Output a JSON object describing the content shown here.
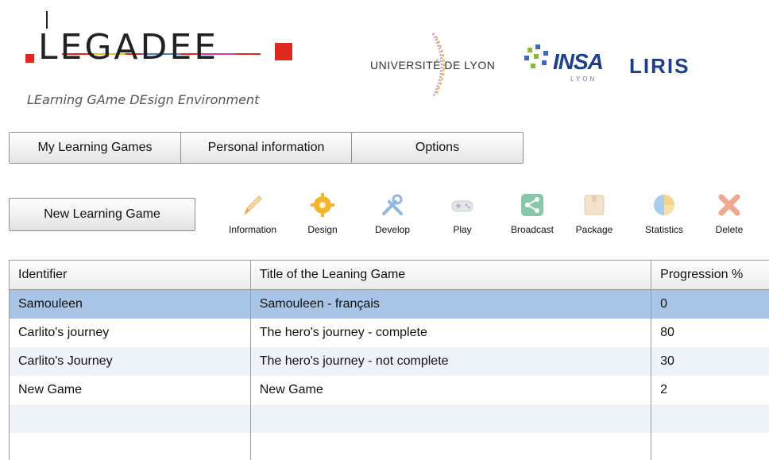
{
  "header": {
    "logo_title": "LEGADEE",
    "logo_tagline": "LEarning GAme DEsign Environment",
    "partners": {
      "univ": "UNIVERSITÉ DE LYON",
      "insa": "INSA",
      "insa_sub": "LYON",
      "liris": "LIRIS"
    }
  },
  "tabs": [
    {
      "label": "My Learning Games"
    },
    {
      "label": "Personal information"
    },
    {
      "label": "Options"
    }
  ],
  "new_game_button": "New Learning Game",
  "toolbar": [
    {
      "label": "Information",
      "icon": "pencil-icon"
    },
    {
      "label": "Design",
      "icon": "gear-icon"
    },
    {
      "label": "Develop",
      "icon": "tools-icon"
    },
    {
      "label": "Play",
      "icon": "gamepad-icon"
    },
    {
      "label": "Broadcast",
      "icon": "share-icon"
    },
    {
      "label": "Package",
      "icon": "package-icon"
    },
    {
      "label": "Statistics",
      "icon": "pie-chart-icon"
    },
    {
      "label": "Delete",
      "icon": "delete-icon"
    }
  ],
  "table": {
    "columns": [
      "Identifier",
      "Title of the Leaning Game",
      "Progression %"
    ],
    "rows": [
      [
        "Samouleen",
        "Samouleen - français",
        "0"
      ],
      [
        "Carlito's journey",
        "The hero's journey - complete",
        "80"
      ],
      [
        "Carlito's Journey",
        "The hero's journey - not complete",
        "30"
      ],
      [
        "New Game",
        "New Game",
        "2"
      ],
      [
        "",
        "",
        ""
      ],
      [
        "",
        "",
        ""
      ]
    ]
  },
  "colors": {
    "selected_row": "#a8c4e6",
    "alt_row": "#eef2f9",
    "brand_red": "#e0281e",
    "brand_blue": "#1d3e8a"
  }
}
